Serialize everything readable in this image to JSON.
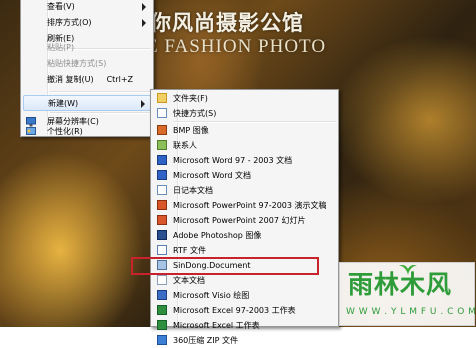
{
  "background": {
    "title_cn": "你风尚摄影公馆",
    "title_en": "E FASHION PHOTO"
  },
  "context_menu": {
    "items": [
      {
        "label": "查看(V)",
        "submenu": true
      },
      {
        "label": "排序方式(O)",
        "submenu": true
      },
      {
        "label": "刷新(E)"
      },
      {
        "label": "粘贴(P)",
        "disabled": true
      },
      {
        "label": "粘贴快捷方式(S)",
        "disabled": true
      },
      {
        "label": "撤消 复制(U)",
        "shortcut": "Ctrl+Z"
      },
      {
        "label": "新建(W)",
        "submenu": true,
        "highlighted": true
      },
      {
        "label": "屏幕分辨率(C)",
        "icon": "monitor-icon"
      },
      {
        "label": "个性化(R)",
        "icon": "personalize-icon"
      }
    ]
  },
  "new_submenu": {
    "items": [
      {
        "label": "文件夹(F)",
        "icon": "folder-icon"
      },
      {
        "label": "快捷方式(S)",
        "icon": "shortcut-icon"
      },
      {
        "label": "BMP 图像",
        "icon": "bmp-icon"
      },
      {
        "label": "联系人",
        "icon": "contact-icon"
      },
      {
        "label": "Microsoft Word 97 - 2003 文档",
        "icon": "word-icon"
      },
      {
        "label": "Microsoft Word 文档",
        "icon": "word-icon"
      },
      {
        "label": "日记本文档",
        "icon": "journal-icon"
      },
      {
        "label": "Microsoft PowerPoint 97-2003 演示文稿",
        "icon": "powerpoint-icon"
      },
      {
        "label": "Microsoft PowerPoint 2007 幻灯片",
        "icon": "powerpoint-icon"
      },
      {
        "label": "Adobe Photoshop 图像",
        "icon": "photoshop-icon"
      },
      {
        "label": "RTF 文件",
        "icon": "rtf-icon"
      },
      {
        "label": "SinDong.Document",
        "icon": "document-icon"
      },
      {
        "label": "文本文档",
        "icon": "text-document-icon",
        "highlighted": true
      },
      {
        "label": "Microsoft Visio 绘图",
        "icon": "visio-icon"
      },
      {
        "label": "Microsoft Excel 97-2003 工作表",
        "icon": "excel-icon"
      },
      {
        "label": "Microsoft Excel 工作表",
        "icon": "excel-icon"
      },
      {
        "label": "360压缩 ZIP 文件",
        "icon": "zip-icon"
      }
    ]
  },
  "watermark": {
    "main": "雨林木风",
    "url": "W W W . Y L M F U . C O M"
  },
  "colors": {
    "highlight_box": "#c8232c",
    "watermark_green": "#2f9c3a"
  }
}
